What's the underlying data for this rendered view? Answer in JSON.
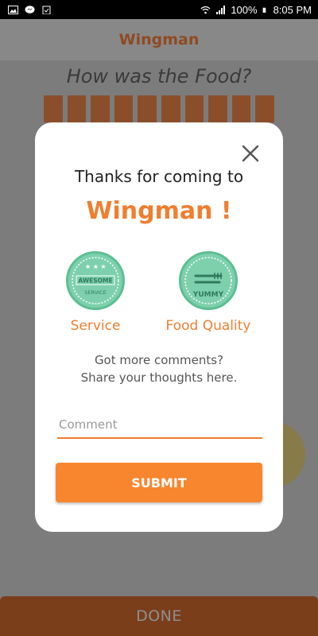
{
  "status_bar": {
    "battery": "100%",
    "time": "8:05 PM"
  },
  "app": {
    "title": "Wingman",
    "question": "How was the Food?",
    "done_label": "DONE"
  },
  "modal": {
    "thanks_text": "Thanks for coming to",
    "brand": "Wingman !",
    "badges": [
      {
        "label": "Service",
        "stamp_text": "AWESOME SERVICE",
        "icon": "stars-icon"
      },
      {
        "label": "Food Quality",
        "stamp_text": "YUMMY",
        "icon": "fork-knife-icon"
      }
    ],
    "comments_line1": "Got more comments?",
    "comments_line2": "Share your thoughts here.",
    "comment_placeholder": "Comment",
    "comment_value": "",
    "submit_label": "SUBMIT"
  },
  "colors": {
    "accent": "#f07e2f",
    "button": "#f8862e",
    "badge": "#7ed0ad",
    "overlay": "#7f7f7f"
  }
}
